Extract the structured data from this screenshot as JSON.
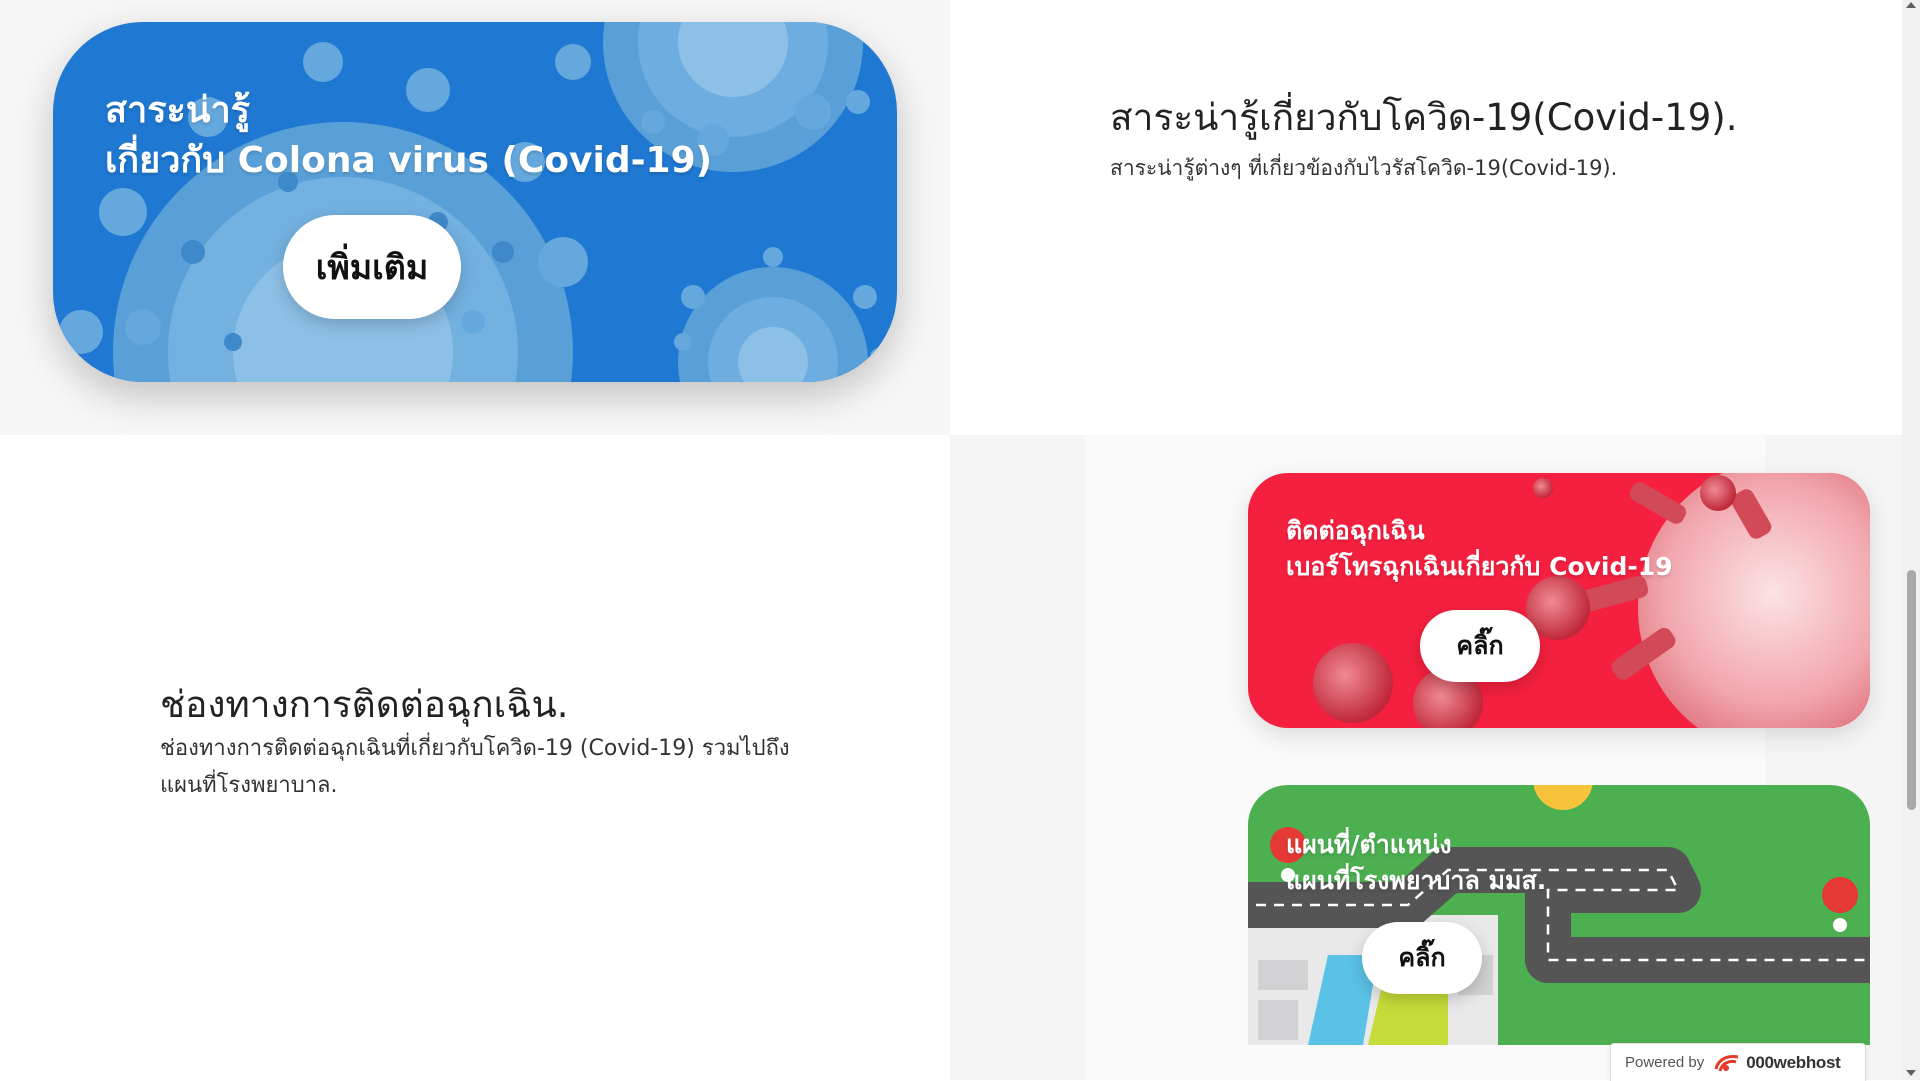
{
  "covid_info_card": {
    "title_line1": "สาระน่ารู้",
    "title_line2": "เกี่ยวกับ Colona virus (Covid-19)",
    "button_label": "เพิ่มเติม"
  },
  "covid_info_section": {
    "heading": "สาระน่ารู้เกี่ยวกับโควิด-19(Covid-19).",
    "subtext": "สาระน่ารู้ต่างๆ ที่เกี่ยวข้องกับไวรัสโควิด-19(Covid-19)."
  },
  "emergency_section": {
    "heading": "ช่องทางการติดต่อฉุกเฉิน.",
    "subtext": "ช่องทางการติดต่อฉุกเฉินที่เกี่ยวกับโควิด-19 (Covid-19) รวมไปถึงแผนที่โรงพยาบาล."
  },
  "emergency_card": {
    "title_line1": "ติดต่อฉุกเฉิน",
    "title_line2": "เบอร์โทรฉุกเฉินเกี่ยวกับ Covid-19",
    "button_label": "คลิ๊ก"
  },
  "map_card": {
    "title_line1": "แผนที่/ตำแหน่ง",
    "title_line2": "แผนที่โรงพยาบาล มมส.",
    "button_label": "คลิ๊ก"
  },
  "hosting_badge": {
    "powered_text": "Powered by",
    "brand": "000webhost"
  },
  "colors": {
    "blue_card": "#1f78d1",
    "red_card": "#f5203f",
    "green_card": "#4caf50"
  }
}
